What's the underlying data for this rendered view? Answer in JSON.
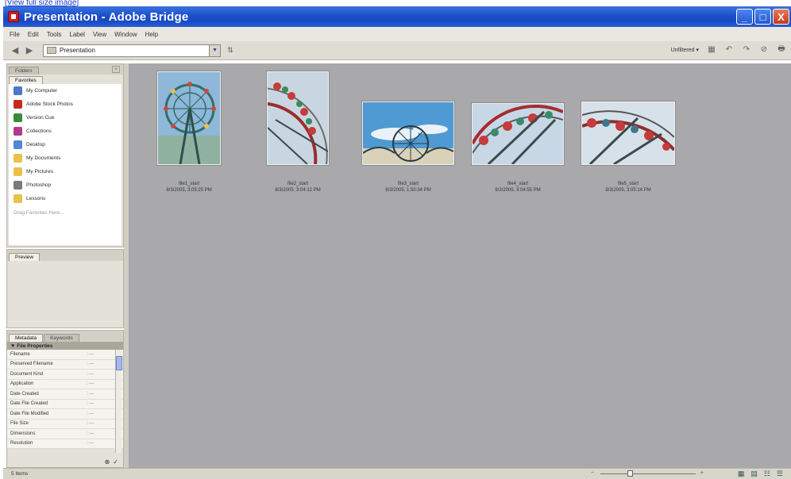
{
  "caption_link": "[View full size image]",
  "window": {
    "title": "Presentation - Adobe Bridge",
    "minimize": "_",
    "maximize": "□",
    "close": "X"
  },
  "menu": [
    "File",
    "Edit",
    "Tools",
    "Label",
    "View",
    "Window",
    "Help"
  ],
  "toolbar": {
    "back": "◀",
    "forward": "▶",
    "path": "Presentation",
    "dropdown": "▼",
    "go": "⇅",
    "sort_label": "Unfiltered ▾",
    "icons": [
      "▦",
      "↶",
      "↷",
      "⊘",
      "🖶"
    ]
  },
  "folders_panel": {
    "tabs": [
      "Folders",
      "Favorites"
    ],
    "close": "×",
    "favorites": [
      {
        "label": "My Computer",
        "icon": "computer-icon",
        "color": "#4b78c8"
      },
      {
        "label": "Adobe Stock Photos",
        "icon": "stock-photos-icon",
        "color": "#c52a1c"
      },
      {
        "label": "Version Cue",
        "icon": "version-cue-icon",
        "color": "#3a8a3a"
      },
      {
        "label": "Collections",
        "icon": "collections-icon",
        "color": "#b23a8a"
      },
      {
        "label": "Desktop",
        "icon": "desktop-icon",
        "color": "#4f86d8"
      },
      {
        "label": "My Documents",
        "icon": "folder-icon",
        "color": "#e8c24a"
      },
      {
        "label": "My Pictures",
        "icon": "folder-icon",
        "color": "#e8c24a"
      },
      {
        "label": "Photoshop",
        "icon": "photoshop-icon",
        "color": "#7a7a7a"
      },
      {
        "label": "Lessons",
        "icon": "folder-icon",
        "color": "#e8c24a"
      }
    ],
    "hint": "Drag Favorites Here..."
  },
  "preview_panel": {
    "tab": "Preview"
  },
  "metadata_panel": {
    "tabs": [
      "Metadata",
      "Keywords"
    ],
    "section": "▼ File Properties",
    "rows": [
      {
        "key": "Filename",
        "value": ": ---"
      },
      {
        "key": "Preserved Filename",
        "value": ": ---"
      },
      {
        "key": "Document Kind",
        "value": ": ---"
      },
      {
        "key": "Application",
        "value": ": ---"
      },
      {
        "key": "Date Created",
        "value": ": ---"
      },
      {
        "key": "Date File Created",
        "value": ": ---"
      },
      {
        "key": "Date File Modified",
        "value": ": ---"
      },
      {
        "key": "File Size",
        "value": ": ---"
      },
      {
        "key": "Dimensions",
        "value": ": ---"
      },
      {
        "key": "Resolution",
        "value": ": ---"
      }
    ],
    "footer_icons": [
      "⊕",
      "✓"
    ]
  },
  "thumbnails": [
    {
      "name": "file1_start",
      "date": "8/3/2005, 3:05:25 PM"
    },
    {
      "name": "file2_start",
      "date": "8/3/2005, 3:04:12 PM"
    },
    {
      "name": "file3_start",
      "date": "8/3/2005, 1:50:34 PM"
    },
    {
      "name": "file4_start",
      "date": "8/3/2005, 3:04:55 PM"
    },
    {
      "name": "file5_start",
      "date": "8/3/2005, 3:05:14 PM"
    }
  ],
  "statusbar": {
    "items_label": "5 Items",
    "zoom_minus": "−",
    "zoom_plus": "+",
    "view_icons": [
      "▦",
      "▤",
      "☷",
      "☰"
    ]
  }
}
